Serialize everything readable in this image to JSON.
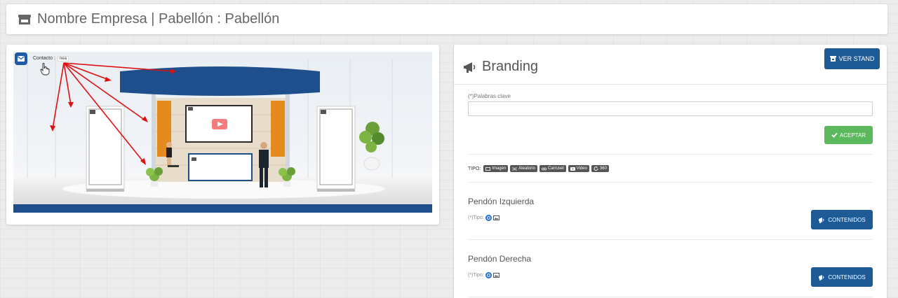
{
  "header": {
    "title": "Nombre Empresa | Pabellón : Pabellón",
    "icon": "store-icon"
  },
  "stand": {
    "contact_label": "Contacto :",
    "contact_value": "nea"
  },
  "branding": {
    "title": "Branding",
    "ver_stand_label": "VER STAND",
    "keywords_label": "(*)Palabras clave",
    "keywords_value": "",
    "accept_label": "ACEPTAR",
    "tipo_label": "TIPO:",
    "tipos": [
      "Imagen",
      "Aleatorio",
      "Carrusel",
      "Video",
      "360"
    ],
    "sections": [
      {
        "title": "Pendón Izquierda",
        "tipo_label": "(*)Tipo:",
        "button_label": "CONTENIDOS"
      },
      {
        "title": "Pendón Derecha",
        "tipo_label": "(*)Tipo:",
        "button_label": "CONTENIDOS"
      }
    ]
  },
  "colors": {
    "primary": "#1d5a96",
    "success": "#5cb85c",
    "stand_blue": "#1e4f8c",
    "stand_orange": "#e58a1f",
    "arrow_red": "#e01010"
  }
}
